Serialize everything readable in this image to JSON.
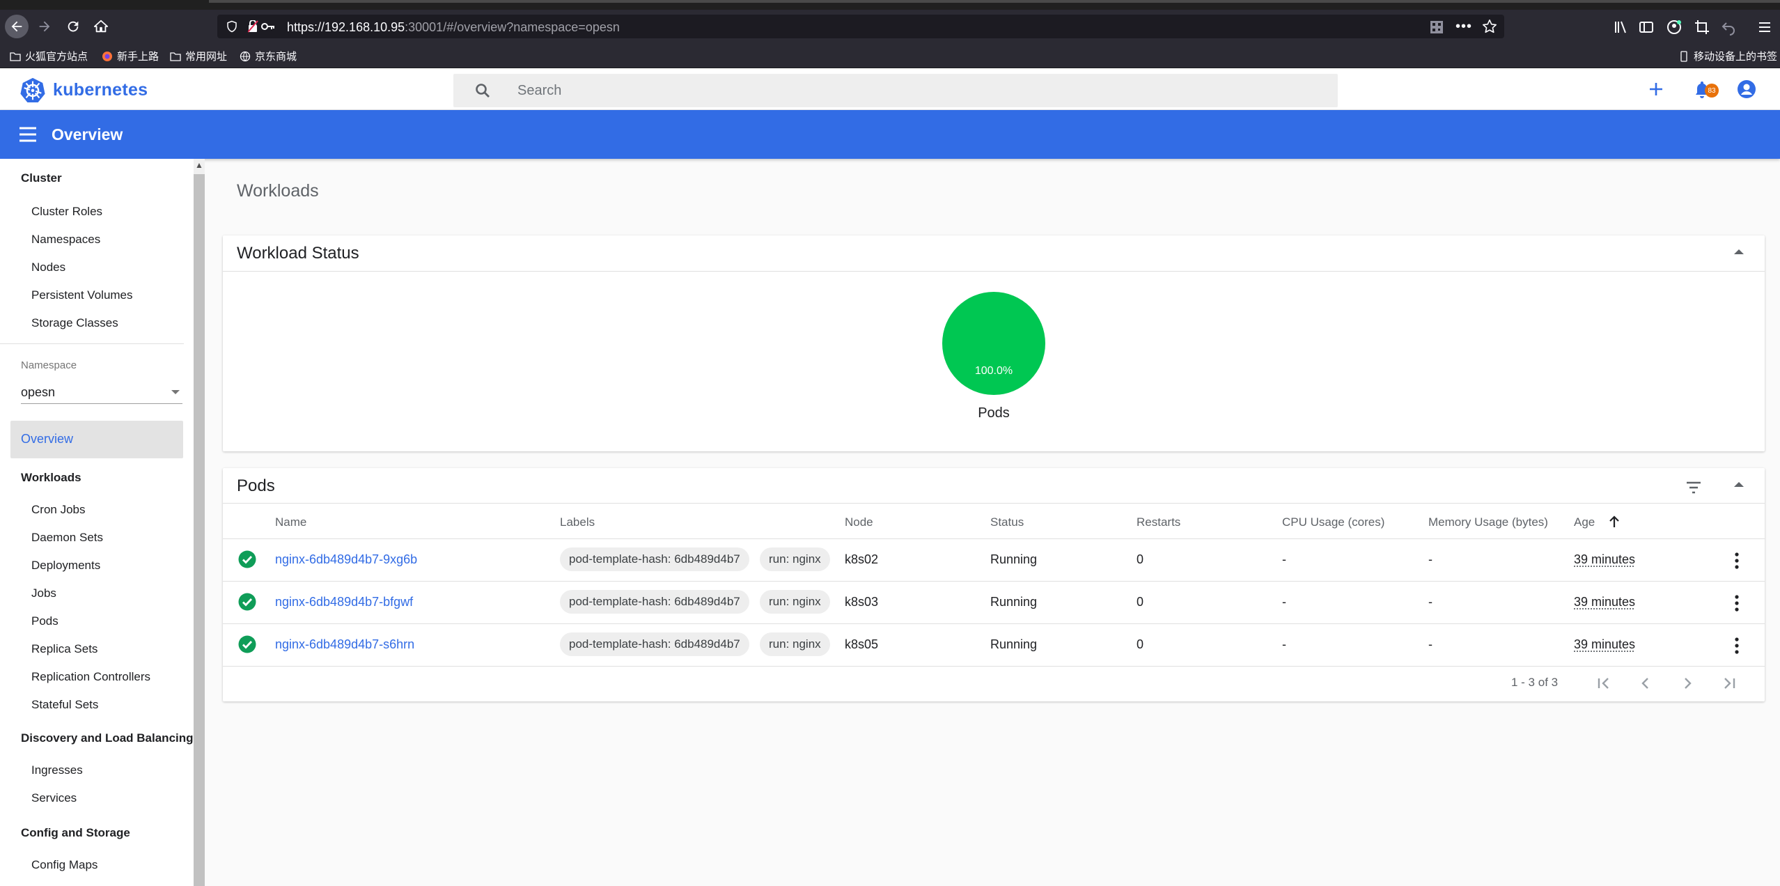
{
  "browser": {
    "url_host": "https://192.168.10.95",
    "url_rest": ":30001/#/overview?namespace=opesn",
    "bookmarks": [
      "火狐官方站点",
      "新手上路",
      "常用网址",
      "京东商城"
    ],
    "mobile_bookmarks": "移动设备上的书签"
  },
  "header": {
    "logo_text": "kubernetes",
    "search_placeholder": "Search",
    "notification_count": "83"
  },
  "toolbar": {
    "title": "Overview"
  },
  "sidebar": {
    "cluster": {
      "title": "Cluster",
      "items": [
        "Cluster Roles",
        "Namespaces",
        "Nodes",
        "Persistent Volumes",
        "Storage Classes"
      ]
    },
    "namespace_label": "Namespace",
    "namespace_value": "opesn",
    "overview": "Overview",
    "workloads": {
      "title": "Workloads",
      "items": [
        "Cron Jobs",
        "Daemon Sets",
        "Deployments",
        "Jobs",
        "Pods",
        "Replica Sets",
        "Replication Controllers",
        "Stateful Sets"
      ]
    },
    "discovery": {
      "title": "Discovery and Load Balancing",
      "items": [
        "Ingresses",
        "Services"
      ]
    },
    "config": {
      "title": "Config and Storage",
      "items": [
        "Config Maps"
      ]
    }
  },
  "main": {
    "heading": "Workloads",
    "workload_status": {
      "title": "Workload Status",
      "pie_percent": "100.0%",
      "pie_label": "Pods",
      "pie_color": "#00c752"
    },
    "pods": {
      "title": "Pods",
      "columns": [
        "Name",
        "Labels",
        "Node",
        "Status",
        "Restarts",
        "CPU Usage (cores)",
        "Memory Usage (bytes)",
        "Age"
      ],
      "rows": [
        {
          "name": "nginx-6db489d4b7-9xg6b",
          "labels": [
            "pod-template-hash: 6db489d4b7",
            "run: nginx"
          ],
          "node": "k8s02",
          "status": "Running",
          "restarts": "0",
          "cpu": "-",
          "memory": "-",
          "age": "39 minutes"
        },
        {
          "name": "nginx-6db489d4b7-bfgwf",
          "labels": [
            "pod-template-hash: 6db489d4b7",
            "run: nginx"
          ],
          "node": "k8s03",
          "status": "Running",
          "restarts": "0",
          "cpu": "-",
          "memory": "-",
          "age": "39 minutes"
        },
        {
          "name": "nginx-6db489d4b7-s6hrn",
          "labels": [
            "pod-template-hash: 6db489d4b7",
            "run: nginx"
          ],
          "node": "k8s05",
          "status": "Running",
          "restarts": "0",
          "cpu": "-",
          "memory": "-",
          "age": "39 minutes"
        }
      ],
      "range": "1 - 3 of 3"
    }
  },
  "colors": {
    "accent": "#326ce5",
    "success": "#0f9d58"
  }
}
